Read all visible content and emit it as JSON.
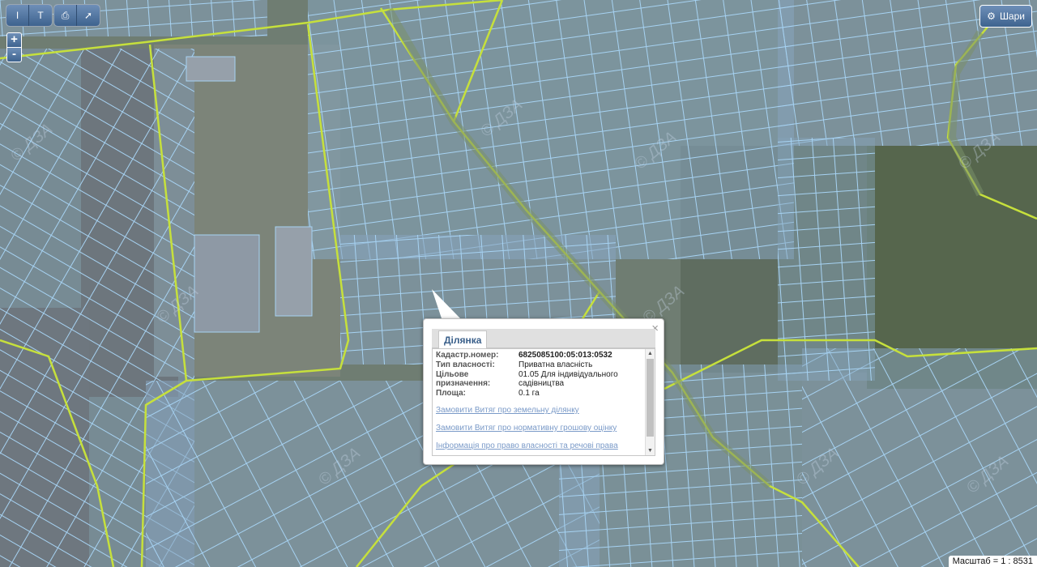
{
  "toolbar": {
    "group1": [
      {
        "icon": "measure-length-icon",
        "glyph": "I"
      },
      {
        "icon": "measure-area-icon",
        "glyph": "T"
      }
    ],
    "group2": [
      {
        "icon": "print-icon",
        "glyph": "⎙"
      },
      {
        "icon": "info-pointer-icon",
        "glyph": "➚"
      }
    ]
  },
  "zoom": {
    "in": "+",
    "out": "-"
  },
  "layers_button": {
    "label": "Шари",
    "icon": "gear-icon"
  },
  "popup": {
    "tab": "Ділянка",
    "rows": [
      {
        "key": "Кадастр.номер:",
        "value": "6825085100:05:013:0532",
        "strong": true
      },
      {
        "key": "Тип власності:",
        "value": "Приватна власність"
      },
      {
        "key": "Цільове призначення:",
        "value": "01.05 Для індивідуального садівництва"
      },
      {
        "key": "Площа:",
        "value": "0.1 га"
      }
    ],
    "links": [
      "Замовити Витяг про земельну ділянку",
      "Замовити Витяг про нормативну грошову оцінку",
      "Інформація про право власності та речові права"
    ]
  },
  "scale_text": "Масштаб = 1 : 8531",
  "watermark": "© ДЗА",
  "colors": {
    "parcel": "#a6d2f2",
    "road": "#c6e03c",
    "popup_link": "#7a9ac8"
  }
}
